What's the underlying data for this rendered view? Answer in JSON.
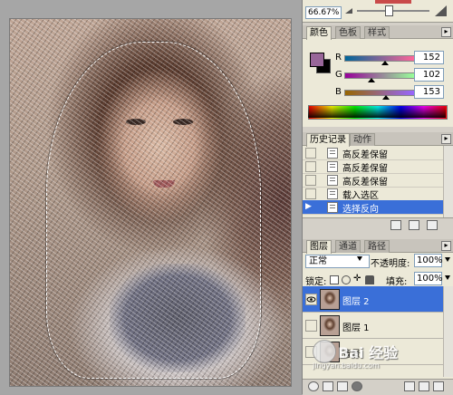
{
  "navigator": {
    "zoom_value": "66.67%",
    "zoom_level_fraction": 0.42
  },
  "color_panel": {
    "tabs": [
      {
        "label": "颜色",
        "active": true
      },
      {
        "label": "色板",
        "active": false
      },
      {
        "label": "样式",
        "active": false
      }
    ],
    "foreground_color": "#986699",
    "background_color": "#000000",
    "channels": [
      {
        "label": "R",
        "value": "152",
        "fraction": 0.596
      },
      {
        "label": "G",
        "value": "102",
        "fraction": 0.4
      },
      {
        "label": "B",
        "value": "153",
        "fraction": 0.6
      }
    ]
  },
  "history_panel": {
    "tabs": [
      {
        "label": "历史记录",
        "active": true
      },
      {
        "label": "动作",
        "active": false
      }
    ],
    "items": [
      {
        "label": "高反差保留",
        "selected": false
      },
      {
        "label": "高反差保留",
        "selected": false
      },
      {
        "label": "高反差保留",
        "selected": false
      },
      {
        "label": "载入选区",
        "selected": false
      },
      {
        "label": "选择反向",
        "selected": true
      }
    ]
  },
  "layers_panel": {
    "tabs": [
      {
        "label": "图层",
        "active": true
      },
      {
        "label": "通道",
        "active": false
      },
      {
        "label": "路径",
        "active": false
      }
    ],
    "blend_mode": "正常",
    "opacity_label": "不透明度:",
    "opacity_value": "100%",
    "lock_label": "锁定:",
    "fill_label": "填充:",
    "fill_value": "100%",
    "layers": [
      {
        "name": "图层 2",
        "selected": true,
        "visible": true
      },
      {
        "name": "图层 1",
        "selected": false,
        "visible": false
      },
      {
        "name": "背景",
        "selected": false,
        "visible": false
      }
    ]
  },
  "watermark": {
    "brand_text": "Bai 经验",
    "url_text": "jingyan.baidu.com"
  },
  "accent_colors": {
    "selection_blue": "#3a6fd8",
    "panel_bg": "#ece9d8",
    "canvas_bg": "#a6a6a6"
  }
}
